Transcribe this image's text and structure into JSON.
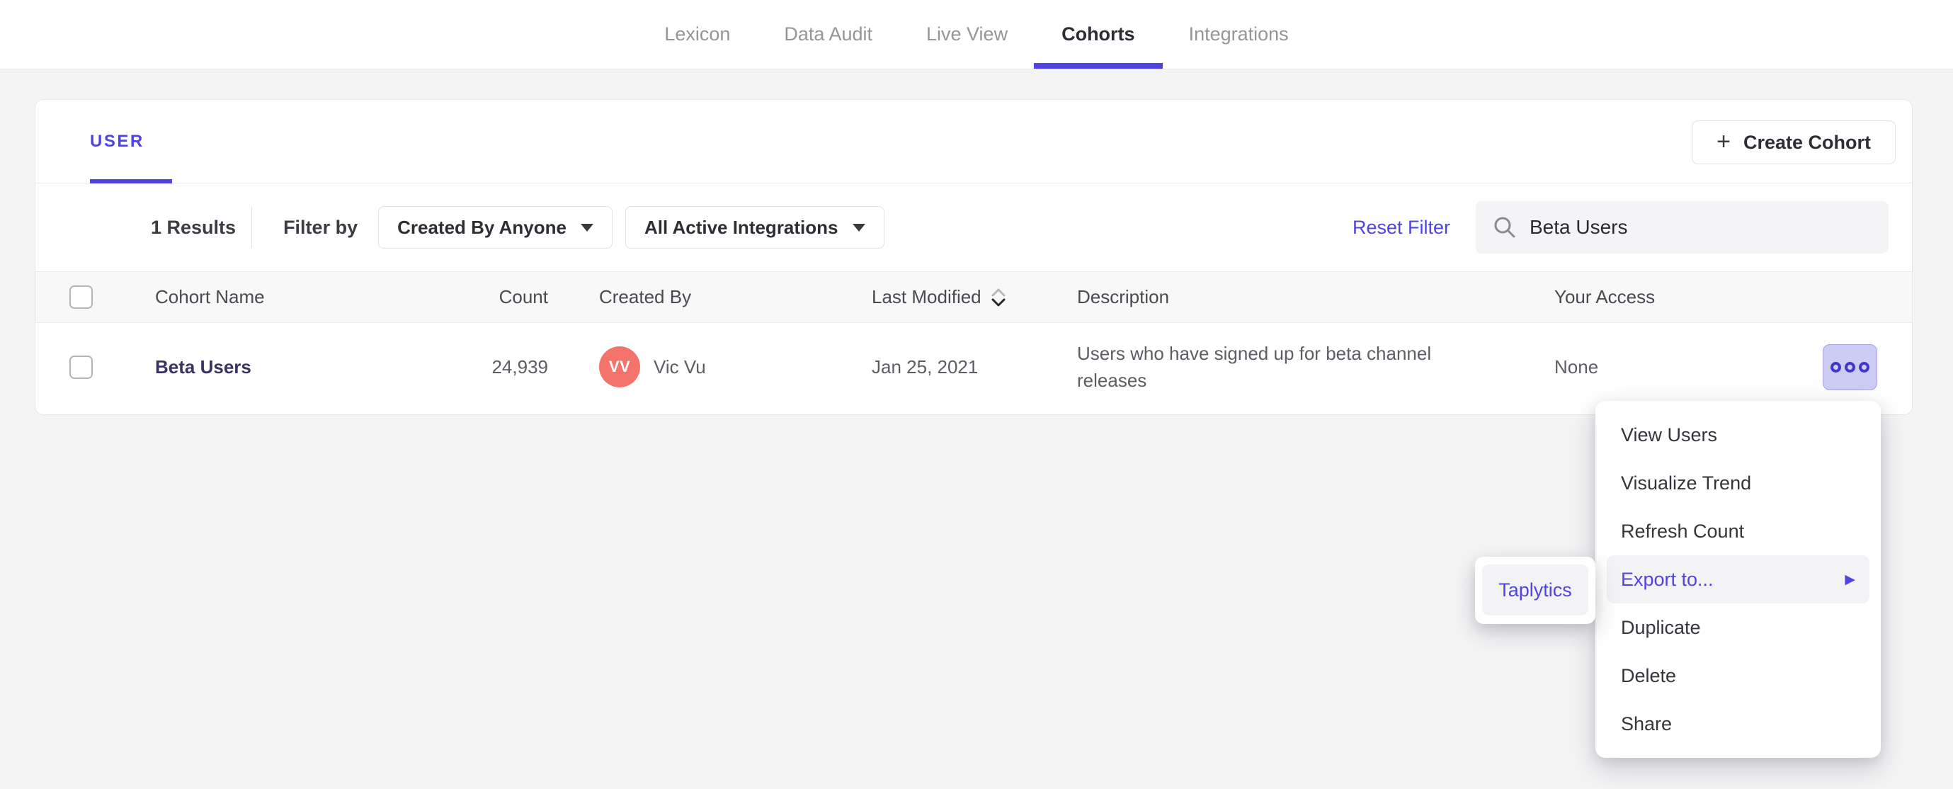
{
  "nav": {
    "items": [
      {
        "label": "Lexicon",
        "active": false
      },
      {
        "label": "Data Audit",
        "active": false
      },
      {
        "label": "Live View",
        "active": false
      },
      {
        "label": "Cohorts",
        "active": true
      },
      {
        "label": "Integrations",
        "active": false
      }
    ]
  },
  "card": {
    "tab_label": "USER",
    "create_button_label": "Create Cohort",
    "create_button_plus": "+",
    "filters": {
      "results_label": "1 Results",
      "filter_by_label": "Filter by",
      "dropdown_created_by": "Created By Anyone",
      "dropdown_integrations": "All Active Integrations",
      "reset_label": "Reset Filter",
      "search_value": "Beta Users"
    },
    "table": {
      "headers": {
        "name": "Cohort Name",
        "count": "Count",
        "created_by": "Created By",
        "last_modified": "Last Modified",
        "description": "Description",
        "access": "Your Access"
      },
      "rows": [
        {
          "name": "Beta Users",
          "count": "24,939",
          "creator_initials": "VV",
          "creator_name": "Vic Vu",
          "last_modified": "Jan 25, 2021",
          "description": "Users who have signed up for beta channel releases",
          "access": "None"
        }
      ]
    }
  },
  "context_menu": {
    "items": [
      {
        "label": "View Users",
        "highlighted": false
      },
      {
        "label": "Visualize Trend",
        "highlighted": false
      },
      {
        "label": "Refresh Count",
        "highlighted": false
      },
      {
        "label": "Export to...",
        "highlighted": true,
        "arrow": "▶"
      },
      {
        "label": "Duplicate",
        "highlighted": false
      },
      {
        "label": "Delete",
        "highlighted": false
      },
      {
        "label": "Share",
        "highlighted": false
      }
    ],
    "submenu_items": [
      {
        "label": "Taplytics"
      }
    ]
  },
  "colors": {
    "accent_purple": "#4f44e0",
    "avatar_coral": "#f4736b",
    "more_button_bg": "#cdccf3",
    "more_button_ring": "#4137ca",
    "page_bg": "#f4f4f5",
    "header_row_bg": "#f8f8f9",
    "highlight_bg": "#f3f3f5"
  }
}
